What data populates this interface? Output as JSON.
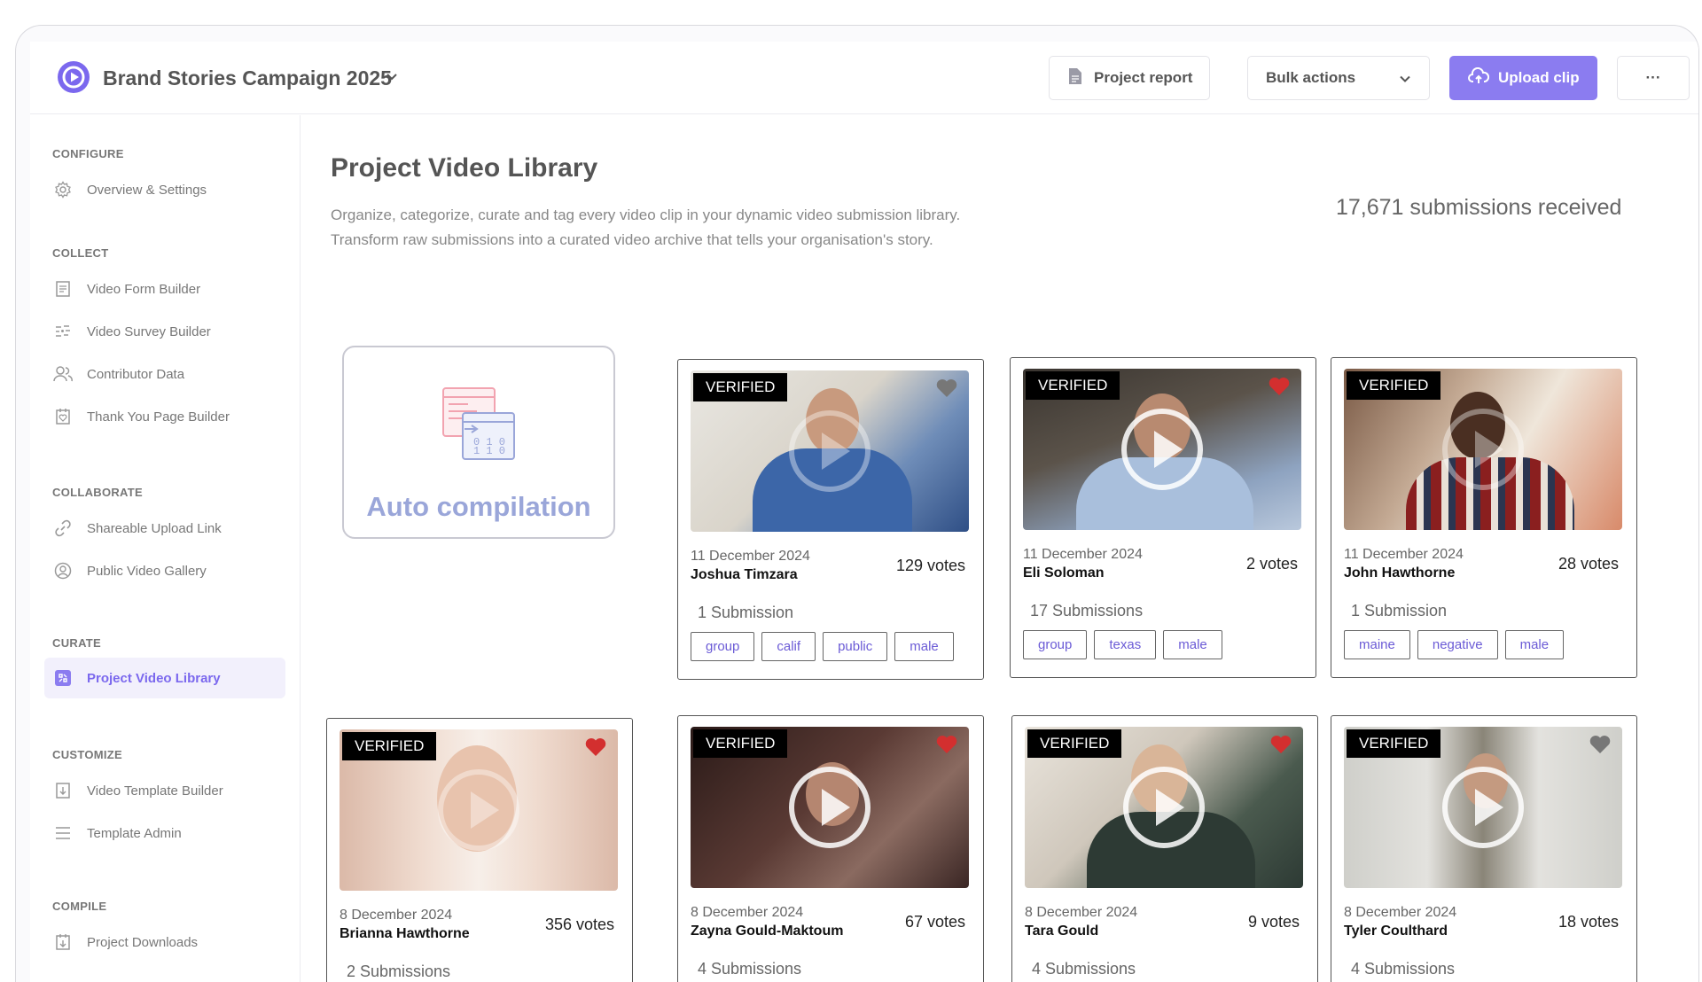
{
  "header": {
    "project_title": "Brand Stories Campaign 2025",
    "report_label": "Project report",
    "bulk_label": "Bulk actions",
    "upload_label": "Upload clip",
    "more_label": "···"
  },
  "sidebar": {
    "sections": [
      {
        "label": "CONFIGURE",
        "items": [
          {
            "label": "Overview & Settings",
            "icon": "gear-icon"
          }
        ]
      },
      {
        "label": "COLLECT",
        "items": [
          {
            "label": "Video Form Builder",
            "icon": "form-icon"
          },
          {
            "label": "Video Survey Builder",
            "icon": "survey-icon"
          },
          {
            "label": "Contributor Data",
            "icon": "people-icon"
          },
          {
            "label": "Thank You Page Builder",
            "icon": "thank-you-icon"
          }
        ]
      },
      {
        "label": "COLLABORATE",
        "items": [
          {
            "label": "Shareable Upload Link",
            "icon": "link-icon"
          },
          {
            "label": "Public Video Gallery",
            "icon": "gallery-icon"
          }
        ]
      },
      {
        "label": "CURATE",
        "items": [
          {
            "label": "Project Video Library",
            "icon": "library-icon",
            "active": true
          }
        ]
      },
      {
        "label": "CUSTOMIZE",
        "items": [
          {
            "label": "Video Template Builder",
            "icon": "template-icon"
          },
          {
            "label": "Template Admin",
            "icon": "list-icon"
          }
        ]
      },
      {
        "label": "COMPILE",
        "items": [
          {
            "label": "Project Downloads",
            "icon": "download-icon"
          }
        ]
      }
    ]
  },
  "main": {
    "title": "Project Video Library",
    "desc_line1": "Organize, categorize, curate and tag every video clip in your dynamic video submission library.",
    "desc_line2": "Transform raw submissions into a curated video archive that tells your organisation's story.",
    "submissions_count": "17,671 submissions received",
    "auto_compilation": "Auto compilation"
  },
  "videos": [
    {
      "badge": "VERIFIED",
      "date": "11 December 2024",
      "name": "Joshua Timzara",
      "votes": "129 votes",
      "subs": "1 Submission",
      "tags": [
        "group",
        "calif",
        "public",
        "male"
      ],
      "liked": false
    },
    {
      "badge": "VERIFIED",
      "date": "11 December 2024",
      "name": "Eli Soloman",
      "votes": "2 votes",
      "subs": "17 Submissions",
      "tags": [
        "group",
        "texas",
        "male"
      ],
      "liked": true
    },
    {
      "badge": "VERIFIED",
      "date": "11 December 2024",
      "name": "John Hawthorne",
      "votes": "28 votes",
      "subs": "1 Submission",
      "tags": [
        "maine",
        "negative",
        "male"
      ],
      "liked": false
    },
    {
      "badge": "VERIFIED",
      "date": "8 December 2024",
      "name": "Brianna Hawthorne",
      "votes": "356 votes",
      "subs": "2 Submissions",
      "tags": [],
      "liked": true
    },
    {
      "badge": "VERIFIED",
      "date": "8 December 2024",
      "name": "Zayna Gould-Maktoum",
      "votes": "67 votes",
      "subs": "4 Submissions",
      "tags": [],
      "liked": true
    },
    {
      "badge": "VERIFIED",
      "date": "8 December 2024",
      "name": "Tara Gould",
      "votes": "9 votes",
      "subs": "4 Submissions",
      "tags": [],
      "liked": true
    },
    {
      "badge": "VERIFIED",
      "date": "8 December 2024",
      "name": "Tyler Coulthard",
      "votes": "18 votes",
      "subs": "4 Submissions",
      "tags": [],
      "liked": false
    }
  ],
  "colors": {
    "accent": "#7b68ee",
    "upload_bg": "#8b7cf0",
    "heart_liked": "#d32f2f",
    "heart_unliked": "#777777"
  }
}
